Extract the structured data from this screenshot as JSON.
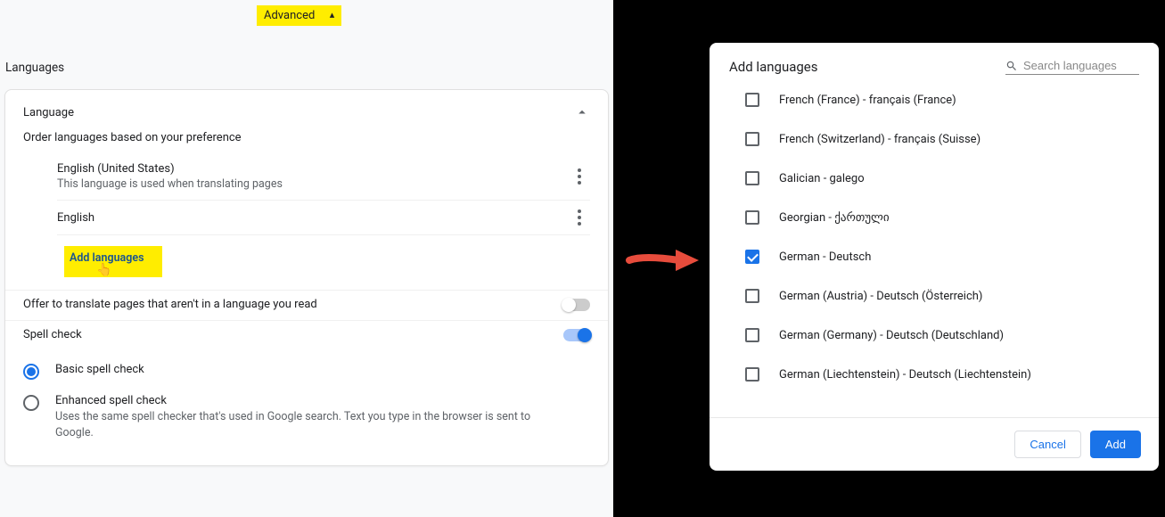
{
  "advanced_label": "Advanced",
  "languages_heading": "Languages",
  "language_section": {
    "title": "Language",
    "order_text": "Order languages based on your preference",
    "items": [
      {
        "name": "English (United States)",
        "note": "This language is used when translating pages"
      },
      {
        "name": "English",
        "note": ""
      }
    ],
    "add_label": "Add languages"
  },
  "translate_row": {
    "label": "Offer to translate pages that aren't in a language you read",
    "enabled": false
  },
  "spell_row": {
    "label": "Spell check",
    "enabled": true
  },
  "spell_options": [
    {
      "label": "Basic spell check",
      "note": "",
      "checked": true
    },
    {
      "label": "Enhanced spell check",
      "note": "Uses the same spell checker that's used in Google search. Text you type in the browser is sent to Google.",
      "checked": false
    }
  ],
  "dialog": {
    "title": "Add languages",
    "search_placeholder": "Search languages",
    "items": [
      {
        "label": "French (France) - français (France)",
        "checked": false
      },
      {
        "label": "French (Switzerland) - français (Suisse)",
        "checked": false
      },
      {
        "label": "Galician - galego",
        "checked": false
      },
      {
        "label": "Georgian - ქართული",
        "checked": false
      },
      {
        "label": "German - Deutsch",
        "checked": true
      },
      {
        "label": "German (Austria) - Deutsch (Österreich)",
        "checked": false
      },
      {
        "label": "German (Germany) - Deutsch (Deutschland)",
        "checked": false
      },
      {
        "label": "German (Liechtenstein) - Deutsch (Liechtenstein)",
        "checked": false
      }
    ],
    "cancel_label": "Cancel",
    "add_label": "Add"
  }
}
